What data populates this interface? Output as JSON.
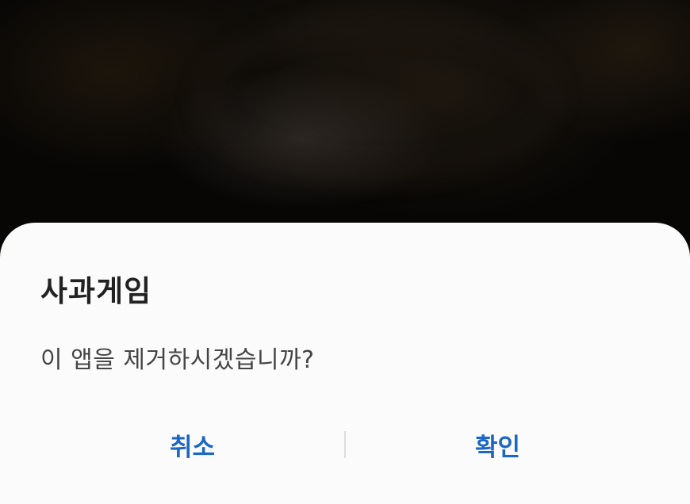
{
  "dialog": {
    "title": "사과게임",
    "message": "이 앱을 제거하시겠습니까?",
    "cancel_label": "취소",
    "confirm_label": "확인"
  },
  "colors": {
    "dialog_background": "#fbfbfb",
    "title_text": "#222222",
    "message_text": "#454545",
    "button_text": "#1a67c4",
    "divider": "#dddddd",
    "backdrop": "#070605"
  }
}
